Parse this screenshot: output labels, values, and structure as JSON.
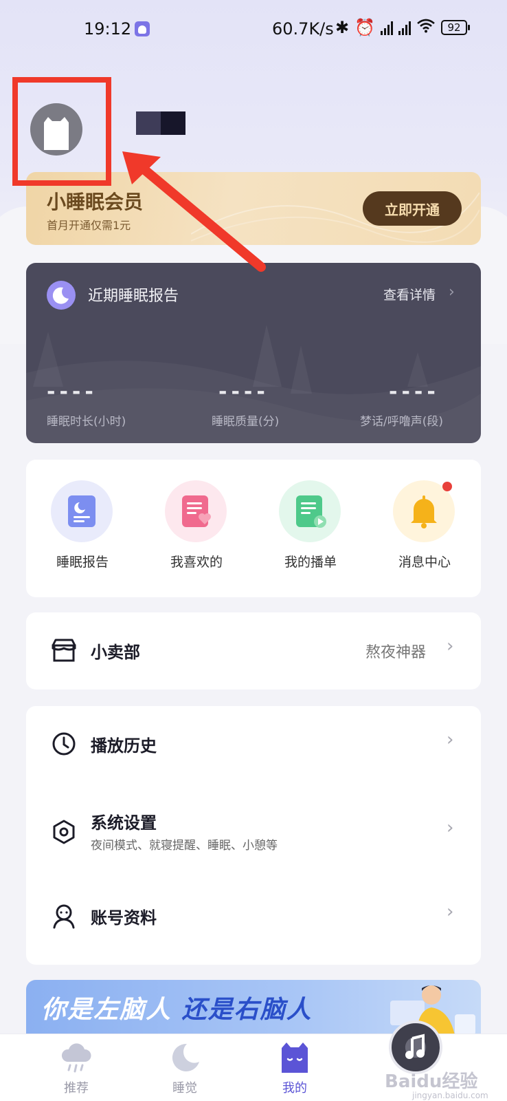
{
  "status_bar": {
    "time": "19:12",
    "net_speed": "60.7K/s",
    "battery": "92"
  },
  "profile": {
    "avatar_icon": "cat-avatar-icon",
    "username_redacted": true
  },
  "member": {
    "title": "小睡眠会员",
    "subtitle": "首月开通仅需1元",
    "button": "立即开通"
  },
  "report": {
    "title": "近期睡眠报告",
    "detail_link": "查看详情",
    "stats": [
      {
        "value": "----",
        "label": "睡眠时长(小时)"
      },
      {
        "value": "----",
        "label": "睡眠质量(分)"
      },
      {
        "value": "----",
        "label": "梦话/呼噜声(段)"
      }
    ]
  },
  "quick_entries": [
    {
      "label": "睡眠报告",
      "icon": "report-icon",
      "color": "#7c8ef0"
    },
    {
      "label": "我喜欢的",
      "icon": "favorite-icon",
      "color": "#f06a8e"
    },
    {
      "label": "我的播单",
      "icon": "playlist-icon",
      "color": "#4ec98a"
    },
    {
      "label": "消息中心",
      "icon": "bell-icon",
      "color": "#f5b21a",
      "badge": true
    }
  ],
  "shop": {
    "title": "小卖部",
    "right_text": "熬夜神器"
  },
  "menu": [
    {
      "title": "播放历史",
      "subtitle": "",
      "icon": "clock-icon"
    },
    {
      "title": "系统设置",
      "subtitle": "夜间模式、就寝提醒、睡眠、小憩等",
      "icon": "settings-icon"
    },
    {
      "title": "账号资料",
      "subtitle": "",
      "icon": "user-icon"
    }
  ],
  "banner": {
    "text_part1": "你是左脑人",
    "text_part2": "还是右脑人"
  },
  "tabs": [
    {
      "label": "推荐",
      "icon": "cloud-rain-icon",
      "active": false
    },
    {
      "label": "睡觉",
      "icon": "moon-icon",
      "active": false
    },
    {
      "label": "我的",
      "icon": "cat-icon",
      "active": true
    }
  ],
  "watermark": {
    "text": "Baidu经验",
    "url": "jingyan.baidu.com"
  },
  "colors": {
    "accent": "#5b54d6",
    "highlight_red": "#f0392a",
    "report_bg": "#4b4a5c",
    "member_btn": "#55391e"
  }
}
